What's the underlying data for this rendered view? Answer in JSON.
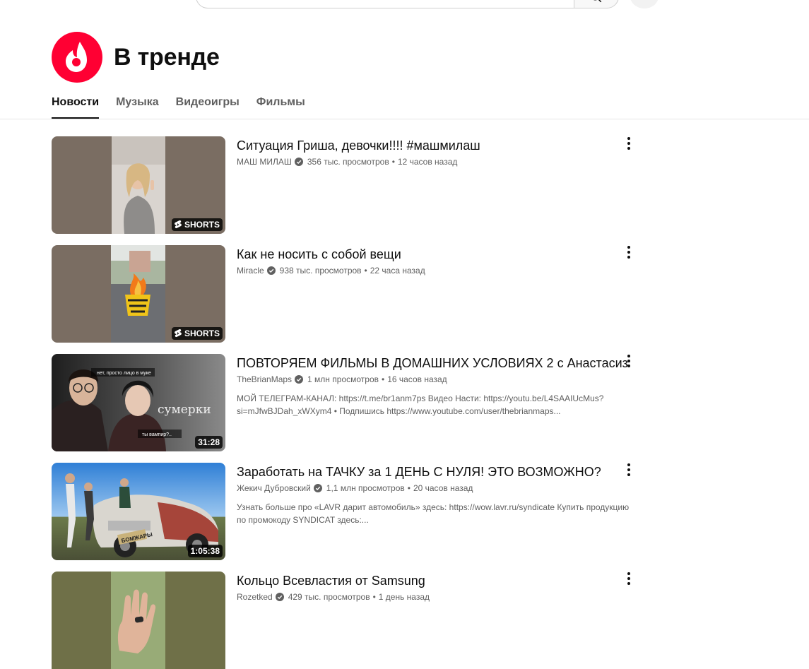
{
  "page": {
    "title": "В тренде",
    "tabs": [
      {
        "label": "Новости",
        "active": true
      },
      {
        "label": "Музыка",
        "active": false
      },
      {
        "label": "Видеоигры",
        "active": false
      },
      {
        "label": "Фильмы",
        "active": false
      }
    ]
  },
  "icons": {
    "logo": "trending-flame-icon",
    "search": "search-icon",
    "more": "more-vertical-icon",
    "verified": "verified-check-icon",
    "shorts": "shorts-icon"
  },
  "colors": {
    "brand": "#ff0033",
    "text_primary": "#0f0f0f",
    "text_secondary": "#606060"
  },
  "videos": [
    {
      "title": "Ситуация Гриша, девочки!!!! #машмилаш",
      "channel": "МАШ МИЛАШ",
      "views": "356 тыс. просмотров",
      "age": "12 часов назад",
      "badge": "SHORTS",
      "description": ""
    },
    {
      "title": "Как не носить с собой вещи",
      "channel": "Miracle",
      "views": "938 тыс. просмотров",
      "age": "22 часа назад",
      "badge": "SHORTS",
      "description": ""
    },
    {
      "title": "ПОВТОРЯЕМ ФИЛЬМЫ В ДОМАШНИХ УСЛОВИЯХ 2 с Анастасиз",
      "channel": "TheBrianMaps",
      "views": "1 млн просмотров",
      "age": "16 часов назад",
      "badge": "31:28",
      "description": "МОЙ ТЕЛЕГРАМ-КАНАЛ: https://t.me/br1anm7ps Видео Насти: https://youtu.be/L4SAAIUcMus?si=mJfwBJDah_xWXym4 • Подпишись https://www.youtube.com/user/thebrianmaps...",
      "thumb_text_1": "нет, просто лицо в муке",
      "thumb_text_2": "сумерки",
      "thumb_text_3": "ты вампир?.."
    },
    {
      "title": "Заработать на ТАЧКУ за 1 ДЕНЬ С НУЛЯ! ЭТО ВОЗМОЖНО?",
      "channel": "Жекич Дубровский",
      "views": "1,1 млн просмотров",
      "age": "20 часов назад",
      "badge": "1:05:38",
      "description": "Узнать больше про «LAVR дарит автомобиль» здесь: https://wow.lavr.ru/syndicate Купить продукцию по промокоду SYNDICAT здесь:...",
      "thumb_text_1": "БОМЖАРЫ"
    },
    {
      "title": "Кольцо Всевластия от Samsung",
      "channel": "Rozetked",
      "views": "429 тыс. просмотров",
      "age": "1 день назад",
      "badge": "",
      "description": ""
    }
  ]
}
